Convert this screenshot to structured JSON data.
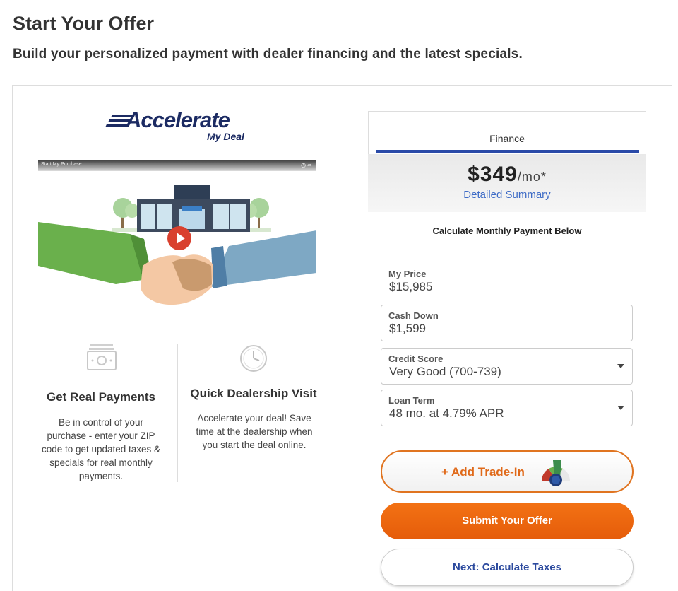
{
  "page": {
    "title": "Start Your Offer",
    "subtitle": "Build your personalized payment with dealer financing and the latest specials."
  },
  "logo": {
    "brand": "Accelerate",
    "tagline": "My Deal"
  },
  "video": {
    "caption": "Start My Purchase"
  },
  "features": [
    {
      "icon": "cash-icon",
      "title": "Get Real Payments",
      "text": "Be in control of your purchase - enter your ZIP code to get updated taxes & specials for real monthly payments."
    },
    {
      "icon": "clock-icon",
      "title": "Quick Dealership Visit",
      "text": "Accelerate your deal! Save time at the dealership when you start the deal online."
    }
  ],
  "payment": {
    "tab_label": "Finance",
    "amount": "$349",
    "per": "/mo*",
    "summary_link": "Detailed Summary",
    "calc_label": "Calculate Monthly Payment Below"
  },
  "form": {
    "price_label": "My Price",
    "price_value": "$15,985",
    "cash_down_label": "Cash Down",
    "cash_down_value": "$1,599",
    "credit_label": "Credit Score",
    "credit_value": "Very Good (700-739)",
    "term_label": "Loan Term",
    "term_value": "48 mo. at 4.79% APR"
  },
  "buttons": {
    "trade_in": "+ Add Trade-In",
    "submit": "Submit Your Offer",
    "next": "Next: Calculate Taxes"
  },
  "colors": {
    "brand_navy": "#1c2b63",
    "accent_orange": "#e55c0a",
    "link_blue": "#3d6bc6",
    "tab_blue": "#2a4aa8"
  }
}
